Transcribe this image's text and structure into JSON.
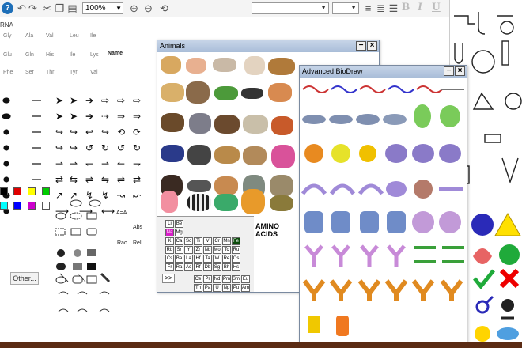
{
  "toolbar": {
    "zoom": "100%"
  },
  "palette": {
    "rna_label": "RNA",
    "amino_rows": [
      [
        "Gly",
        "Ala",
        "Val",
        "Leu",
        "Ile"
      ],
      [
        "Glu",
        "Gln",
        "His",
        "Ile",
        "Lys"
      ],
      [
        "Phe",
        "Ser",
        "Thr",
        "Tyr",
        "Val"
      ]
    ],
    "bond_labels": [
      "A=A",
      "Abs",
      "Rac",
      "Rel",
      "Name"
    ],
    "colors": [
      "#000000",
      "#e00000",
      "#ffff00",
      "#00cc00",
      "#00ffff",
      "#0000ff",
      "#cc00cc",
      "#ffffff"
    ],
    "other_button": "Other..."
  },
  "windows": {
    "animals": {
      "title": "Animals"
    },
    "biodraw": {
      "title": "Advanced BioDraw"
    }
  },
  "periodic": {
    "rows": [
      [
        "Li",
        "Be"
      ],
      [
        "Na",
        "Mg"
      ],
      [
        "K",
        "Ca",
        "Sc",
        "Ti",
        "V",
        "Cr",
        "Mn",
        "Fe"
      ],
      [
        "Rb",
        "Sr",
        "Y",
        "Zr",
        "Nb",
        "Mo",
        "Tc",
        "Ru"
      ],
      [
        "Cs",
        "Ba",
        "La",
        "Hf",
        "Ta",
        "W",
        "Re",
        "Os"
      ],
      [
        "Fr",
        "Ra",
        "Ac",
        "Rf",
        "Db",
        "Sg",
        "Bh",
        "Hs"
      ],
      [
        "Ce",
        "Pr",
        "Nd",
        "Pm",
        "Sm",
        "Eu"
      ],
      [
        "Th",
        "Pa",
        "U",
        "Np",
        "Pu",
        "Am"
      ]
    ],
    "more_button": ">>"
  },
  "amino_panel": {
    "title_line1": "AMINO",
    "title_line2": "ACIDS"
  }
}
